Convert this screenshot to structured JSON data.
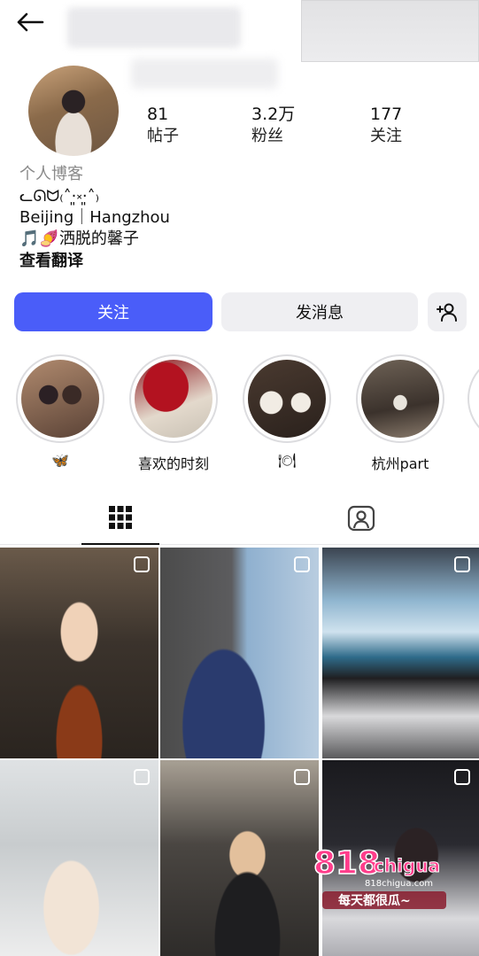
{
  "stats": [
    {
      "value": "81",
      "label": "帖子"
    },
    {
      "value": "3.2万",
      "label": "粉丝"
    },
    {
      "value": "177",
      "label": "关注"
    }
  ],
  "bio": {
    "category": "个人博客",
    "emoticon": "ᓚᘏᗢ₍˄·͈༝·͈˄₎",
    "location": "Beijing｜Hangzhou",
    "tagline": "🎵🍠洒脱的馨子",
    "translate": "查看翻译"
  },
  "actions": {
    "follow": "关注",
    "message": "发消息"
  },
  "highlights": [
    {
      "label": "🦋"
    },
    {
      "label": "喜欢的时刻"
    },
    {
      "label": "🍽"
    },
    {
      "label": "杭州part"
    }
  ],
  "watermark": {
    "brand": "818chigua",
    "url": "818chigua.com",
    "slogan": "每天都很瓜~"
  },
  "colors": {
    "accent": "#4a5df9",
    "secondary_btn": "#efeff2"
  }
}
